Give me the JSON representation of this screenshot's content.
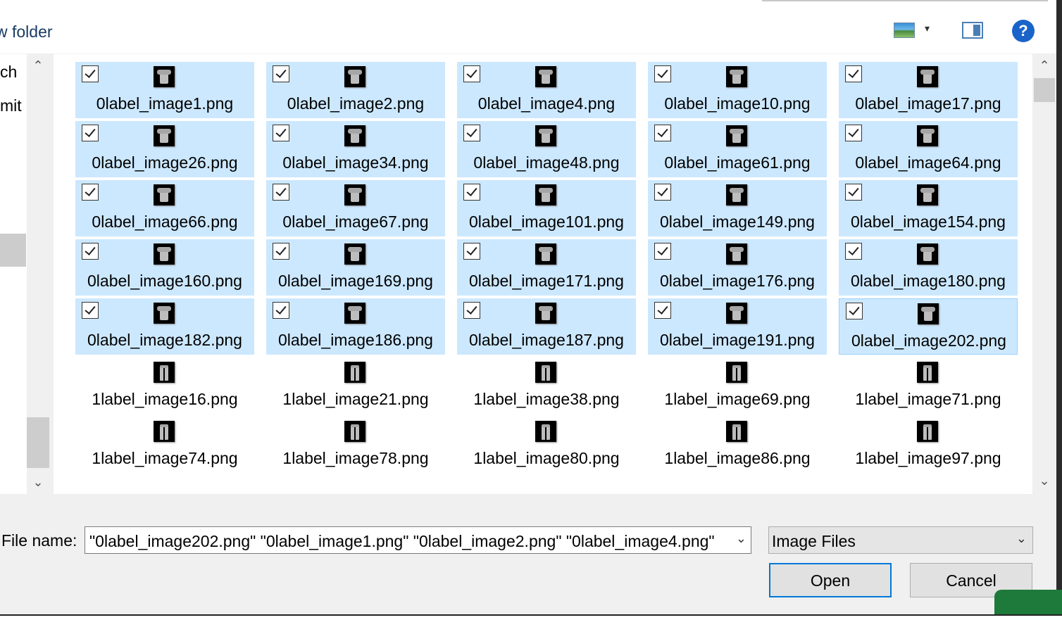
{
  "toolbar": {
    "new_folder_label": "w folder",
    "view_icon": "view-options-icon",
    "preview_pane_icon": "preview-pane-icon",
    "help_icon": "?"
  },
  "nav": {
    "items": [
      {
        "label": "ch"
      },
      {
        "label": "mit"
      }
    ]
  },
  "files": [
    {
      "name": "0label_image1.png",
      "selected": true,
      "kind": "top"
    },
    {
      "name": "0label_image2.png",
      "selected": true,
      "kind": "top"
    },
    {
      "name": "0label_image4.png",
      "selected": true,
      "kind": "top"
    },
    {
      "name": "0label_image10.png",
      "selected": true,
      "kind": "top"
    },
    {
      "name": "0label_image17.png",
      "selected": true,
      "kind": "top"
    },
    {
      "name": "0label_image26.png",
      "selected": true,
      "kind": "top"
    },
    {
      "name": "0label_image34.png",
      "selected": true,
      "kind": "top"
    },
    {
      "name": "0label_image48.png",
      "selected": true,
      "kind": "top"
    },
    {
      "name": "0label_image61.png",
      "selected": true,
      "kind": "top"
    },
    {
      "name": "0label_image64.png",
      "selected": true,
      "kind": "top"
    },
    {
      "name": "0label_image66.png",
      "selected": true,
      "kind": "top"
    },
    {
      "name": "0label_image67.png",
      "selected": true,
      "kind": "top"
    },
    {
      "name": "0label_image101.png",
      "selected": true,
      "kind": "top"
    },
    {
      "name": "0label_image149.png",
      "selected": true,
      "kind": "top"
    },
    {
      "name": "0label_image154.png",
      "selected": true,
      "kind": "top"
    },
    {
      "name": "0label_image160.png",
      "selected": true,
      "kind": "top"
    },
    {
      "name": "0label_image169.png",
      "selected": true,
      "kind": "top"
    },
    {
      "name": "0label_image171.png",
      "selected": true,
      "kind": "top"
    },
    {
      "name": "0label_image176.png",
      "selected": true,
      "kind": "top"
    },
    {
      "name": "0label_image180.png",
      "selected": true,
      "kind": "top"
    },
    {
      "name": "0label_image182.png",
      "selected": true,
      "kind": "top"
    },
    {
      "name": "0label_image186.png",
      "selected": true,
      "kind": "top"
    },
    {
      "name": "0label_image187.png",
      "selected": true,
      "kind": "top"
    },
    {
      "name": "0label_image191.png",
      "selected": true,
      "kind": "top"
    },
    {
      "name": "0label_image202.png",
      "selected": true,
      "focused": true,
      "kind": "top"
    },
    {
      "name": "1label_image16.png",
      "selected": false,
      "kind": "pants"
    },
    {
      "name": "1label_image21.png",
      "selected": false,
      "kind": "pants"
    },
    {
      "name": "1label_image38.png",
      "selected": false,
      "kind": "pants"
    },
    {
      "name": "1label_image69.png",
      "selected": false,
      "kind": "pants"
    },
    {
      "name": "1label_image71.png",
      "selected": false,
      "kind": "pants"
    },
    {
      "name": "1label_image74.png",
      "selected": false,
      "kind": "pants"
    },
    {
      "name": "1label_image78.png",
      "selected": false,
      "kind": "pants"
    },
    {
      "name": "1label_image80.png",
      "selected": false,
      "kind": "pants"
    },
    {
      "name": "1label_image86.png",
      "selected": false,
      "kind": "pants"
    },
    {
      "name": "1label_image97.png",
      "selected": false,
      "kind": "pants"
    }
  ],
  "footer": {
    "filename_label": "File name:",
    "filename_value": "\"0label_image202.png\" \"0label_image1.png\" \"0label_image2.png\" \"0label_image4.png\"",
    "filter_value": "Image Files",
    "open_label": "Open",
    "cancel_label": "Cancel"
  },
  "colors": {
    "selection": "#cce8ff",
    "focus_border": "#99d1ff",
    "default_button_border": "#0078d7"
  }
}
